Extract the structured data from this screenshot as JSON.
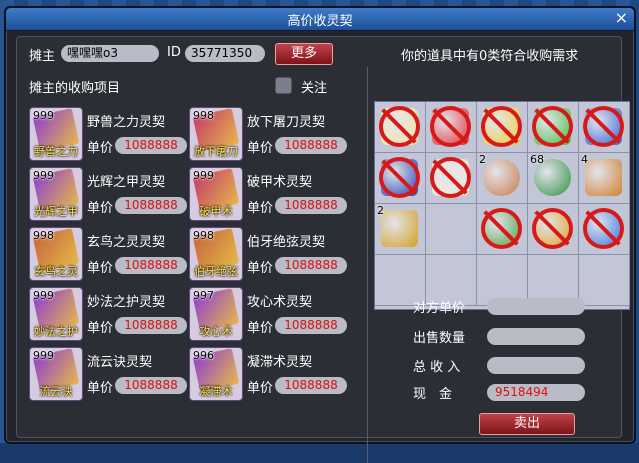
{
  "window": {
    "title": "高价收灵契",
    "close_glyph": "×"
  },
  "header": {
    "stall_owner_label": "摊主",
    "stall_owner_value": "嘿嘿嘿o3",
    "id_label": "ID",
    "id_value": "35771350",
    "more_label": "更多",
    "items_label": "摊主的收购项目",
    "follow_label": "关注"
  },
  "items": [
    {
      "name": "野兽之力灵契",
      "count": "999",
      "icon_label": "野兽之力",
      "unit_label": "单价",
      "price": "1088888",
      "color": "#8f3fd0"
    },
    {
      "name": "放下屠刀灵契",
      "count": "998",
      "icon_label": "放下屠刀",
      "unit_label": "单价",
      "price": "1088888",
      "color": "#c43a6a"
    },
    {
      "name": "光辉之甲灵契",
      "count": "999",
      "icon_label": "光辉之甲",
      "unit_label": "单价",
      "price": "1088888",
      "color": "#8f3fd0"
    },
    {
      "name": "破甲术灵契",
      "count": "999",
      "icon_label": "破甲术",
      "unit_label": "单价",
      "price": "1088888",
      "color": "#c43a6a"
    },
    {
      "name": "玄鸟之灵灵契",
      "count": "998",
      "icon_label": "玄鸟之灵",
      "unit_label": "单价",
      "price": "1088888",
      "color": "#c4663a"
    },
    {
      "name": "伯牙绝弦灵契",
      "count": "998",
      "icon_label": "伯牙绝弦",
      "unit_label": "单价",
      "price": "1088888",
      "color": "#c4663a"
    },
    {
      "name": "妙法之护灵契",
      "count": "999",
      "icon_label": "妙法之护",
      "unit_label": "单价",
      "price": "1088888",
      "color": "#8f3fd0"
    },
    {
      "name": "攻心术灵契",
      "count": "997",
      "icon_label": "攻心术",
      "unit_label": "单价",
      "price": "1088888",
      "color": "#8f3fd0"
    },
    {
      "name": "流云诀灵契",
      "count": "999",
      "icon_label": "流云诀",
      "unit_label": "单价",
      "price": "1088888",
      "color": "#8f3fd0"
    },
    {
      "name": "凝滞术灵契",
      "count": "996",
      "icon_label": "凝滞术",
      "unit_label": "单价",
      "price": "1088888",
      "color": "#8f3fd0"
    }
  ],
  "inventory": {
    "header": "你的道具中有0类符合收购需求",
    "cells": [
      {
        "icon": "yellow-banner-icon",
        "color": "#f2e6a0",
        "count": "",
        "banned": true,
        "round": false
      },
      {
        "icon": "red-banner-icon",
        "color": "#e23030",
        "count": "",
        "banned": true,
        "round": false
      },
      {
        "icon": "yellow-banner-icon",
        "color": "#f0d030",
        "count": "",
        "banned": true,
        "round": false
      },
      {
        "icon": "green-banner-icon",
        "color": "#3fbf3f",
        "count": "",
        "banned": true,
        "round": false
      },
      {
        "icon": "blue-banner-icon",
        "color": "#3060d0",
        "count": "",
        "banned": true,
        "round": false
      },
      {
        "icon": "blue-banner-icon",
        "color": "#2040b0",
        "count": "",
        "banned": true,
        "round": false
      },
      {
        "icon": "white-banner-icon",
        "color": "#f0e8d8",
        "count": "",
        "banned": true,
        "round": false
      },
      {
        "icon": "dumpling-icon",
        "color": "#c87a4a",
        "count": "2",
        "banned": false,
        "round": true
      },
      {
        "icon": "plant-icon",
        "color": "#2f8f3f",
        "count": "68",
        "banned": false,
        "round": true
      },
      {
        "icon": "treasure-chest-icon",
        "color": "#d08030",
        "count": "4",
        "banned": false,
        "round": false
      },
      {
        "icon": "gold-box-icon",
        "color": "#d4a020",
        "count": "2",
        "banned": false,
        "round": false
      },
      {
        "icon": "empty",
        "color": "",
        "count": "",
        "banned": false,
        "round": false
      },
      {
        "icon": "bamboo-icon",
        "color": "#4f9f3f",
        "count": "",
        "banned": true,
        "round": true
      },
      {
        "icon": "fruit-icon",
        "color": "#e0a020",
        "count": "",
        "banned": true,
        "round": true
      },
      {
        "icon": "blue-orb-icon",
        "color": "#3070e0",
        "count": "",
        "banned": true,
        "round": true
      },
      {
        "icon": "empty",
        "color": "",
        "count": "",
        "banned": false,
        "round": false
      },
      {
        "icon": "empty",
        "color": "",
        "count": "",
        "banned": false,
        "round": false
      },
      {
        "icon": "empty",
        "color": "",
        "count": "",
        "banned": false,
        "round": false
      },
      {
        "icon": "empty",
        "color": "",
        "count": "",
        "banned": false,
        "round": false
      },
      {
        "icon": "empty",
        "color": "",
        "count": "",
        "banned": false,
        "round": false
      }
    ]
  },
  "trade": {
    "unit_price_label": "对方单价",
    "unit_price_value": "",
    "quantity_label": "出售数量",
    "quantity_value": "",
    "total_label": "总 收 入",
    "total_value": "",
    "cash_label": "现　金",
    "cash_value": "9518494",
    "sell_label": "卖出"
  }
}
